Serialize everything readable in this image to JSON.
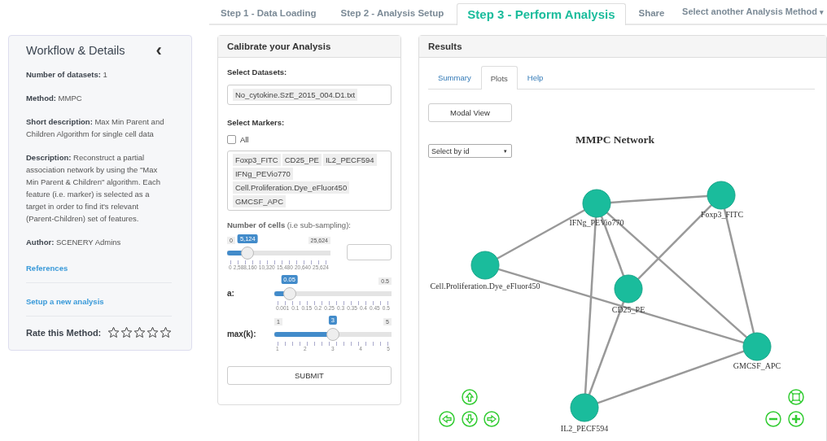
{
  "top_tabs": [
    {
      "label": "Step 1 - Data Loading",
      "selected": false
    },
    {
      "label": "Step 2 - Analysis Setup",
      "selected": false
    },
    {
      "label": "Step 3 - Perform Analysis",
      "selected": true
    },
    {
      "label": "Share",
      "selected": false
    }
  ],
  "method_menu": {
    "label": "Select another Analysis Method",
    "caret": "▾"
  },
  "sidebar": {
    "title": "Workflow & Details",
    "collapse": "‹",
    "details": [
      "**Number of datasets:** 1",
      "**Method:** MMPC",
      "**Short description:** Max Min Parent and Children Algorithm for single cell data",
      "**Description:** Reconstruct a partial association network by using the \"Max Min Parent & Children\" algorithm. Each feature (i.e. marker) is selected as a target in order to find it's relevant (Parent-Children) set of features.",
      "**Author:** SCENERY Admins"
    ],
    "references": "References",
    "setup_link": "Setup a new analysis",
    "rating_label": "Rate this Method:",
    "stars": 0
  },
  "calibrate": {
    "title": "Calibrate your Analysis",
    "datasets_label": "Select Datasets:",
    "datasets": [
      "No_cytokine.SzE_2015_004.D1.txt"
    ],
    "markers_label": "Select Markers:",
    "all_label": "All",
    "all_checked": false,
    "markers": [
      "Foxp3_FITC",
      "CD25_PE",
      "IL2_PECF594",
      "IFNg_PEVio770",
      "Cell.Proliferation.Dye_eFluor450",
      "GMCSF_APC"
    ],
    "cells_label": "**Number of cells** (i.e sub-sampling):",
    "sliders": [
      {
        "min": "0",
        "max": "25,624",
        "value": "5,124",
        "level": 0.2,
        "ticks": [
          "0",
          "2,588,160",
          "10,320",
          "15,480",
          "20,640",
          "25,624"
        ],
        "has_input": true
      },
      {
        "label": "a:",
        "max": "0.5",
        "value": "0.05",
        "level": 0.13,
        "ticks": [
          "0.001",
          "0.1",
          "0.15",
          "0.2",
          "0.25",
          "0.3",
          "0.35",
          "0.4",
          "0.45",
          "0.5"
        ],
        "has_input": false
      },
      {
        "label": "max(k):",
        "min": "1",
        "max": "5",
        "value": "3",
        "level": 0.5,
        "ticks": [
          "1",
          "2",
          "3",
          "4",
          "5"
        ],
        "has_input": false
      }
    ],
    "submit": "SUBMIT"
  },
  "results": {
    "title": "Results",
    "tabs": [
      {
        "label": "Summary",
        "selected": false
      },
      {
        "label": "Plots",
        "selected": true
      },
      {
        "label": "Help",
        "selected": false
      }
    ],
    "modal_button": "Modal View",
    "select": {
      "value": "Select by id",
      "caret": "▾"
    },
    "network_title": "MMPC Network",
    "nodes": [
      {
        "label": "IFNg_PEVio770"
      },
      {
        "label": "Foxp3_FITC"
      },
      {
        "label": "Cell.Proliferation.Dye_eFluor450"
      },
      {
        "label": "CD25_PE"
      },
      {
        "label": "GMCSF_APC"
      },
      {
        "label": "IL2_PECF594"
      }
    ]
  }
}
